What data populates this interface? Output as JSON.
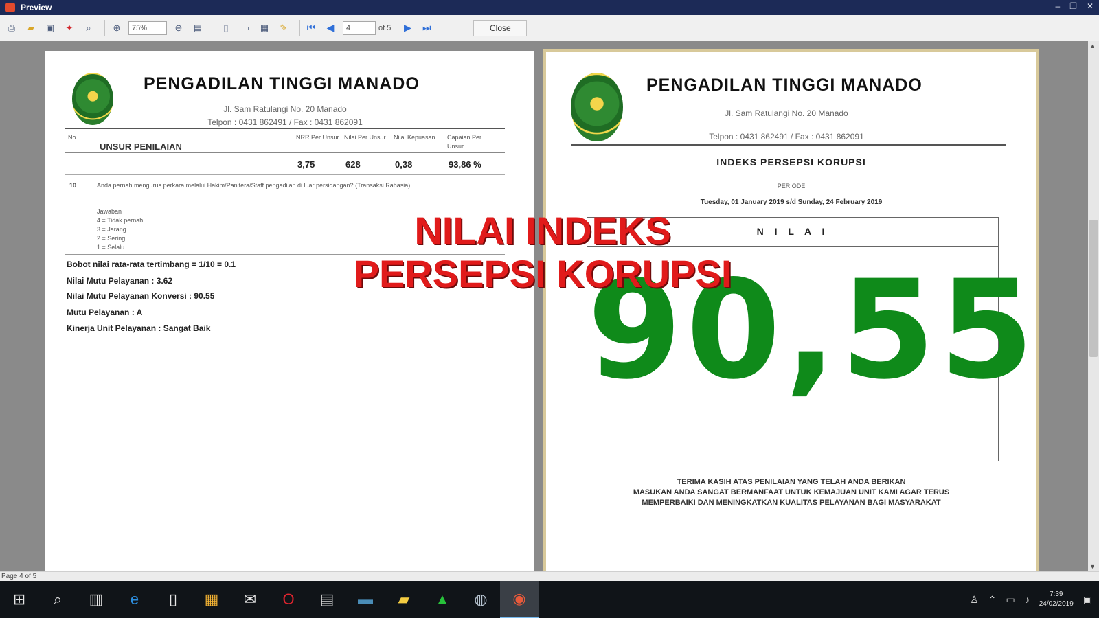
{
  "window": {
    "title": "Preview"
  },
  "toolbar": {
    "zoom": "75%",
    "page_value": "4",
    "of_label": "of 5",
    "close_label": "Close"
  },
  "overlay": {
    "line1": "NILAI INDEKS",
    "line2": "PERSEPSI KORUPSI"
  },
  "left_page": {
    "title": "PENGADILAN TINGGI MANADO",
    "address": "Jl. Sam Ratulangi No. 20 Manado",
    "phone": "Telpon : 0431 862491 / Fax : 0431 862091",
    "table": {
      "col_no": "No.",
      "col_unsur": "UNSUR PENILAIAN",
      "col_nrr": "NRR Per Unsur",
      "col_nilai": "Nilai Per Unsur",
      "col_kepuasan": "Nilai Kepuasan",
      "col_capaian": "Capaian Per Unsur",
      "nrr_value": "3,75",
      "nilai_value": "628",
      "kepuasan_value": "0,38",
      "capaian_value": "93,86 %",
      "item_no": "10",
      "item_question": "Anda pernah mengurus perkara melalui Hakim/Panitera/Staff pengadilan di luar persidangan? (Transaksi Rahasia)",
      "answers": [
        "Jawaban",
        "4 = Tidak pernah",
        "3 = Jarang",
        "2 = Sering",
        "1 = Selalu"
      ]
    },
    "summary": [
      "Bobot nilai rata-rata tertimbang = 1/10 = 0.1",
      "Nilai Mutu Pelayanan : 3.62",
      "Nilai Mutu Pelayanan Konversi : 90.55",
      "Mutu Pelayanan : A",
      "Kinerja Unit Pelayanan : Sangat Baik"
    ]
  },
  "right_page": {
    "title": "PENGADILAN TINGGI MANADO",
    "address": "Jl. Sam Ratulangi No. 20 Manado",
    "phone": "Telpon : 0431 862491 / Fax : 0431 862091",
    "indeks_title": "INDEKS PERSEPSI KORUPSI",
    "periode_label": "PERIODE",
    "periode_range": "Tuesday, 01 January 2019 s/d Sunday, 24 February 2019",
    "nilai_label": "N I L A I",
    "score": "90,55",
    "thanks_1": "TERIMA KASIH ATAS PENILAIAN YANG TELAH ANDA BERIKAN",
    "thanks_2": "MASUKAN ANDA SANGAT BERMANFAAT UNTUK KEMAJUAN UNIT KAMI AGAR TERUS",
    "thanks_3": "MEMPERBAIKI DAN MENINGKATKAN KUALITAS PELAYANAN BAGI MASYARAKAT"
  },
  "statusbar": {
    "text": "Page 4 of 5"
  },
  "taskbar": {
    "time": "7:39",
    "date": "24/02/2019"
  }
}
